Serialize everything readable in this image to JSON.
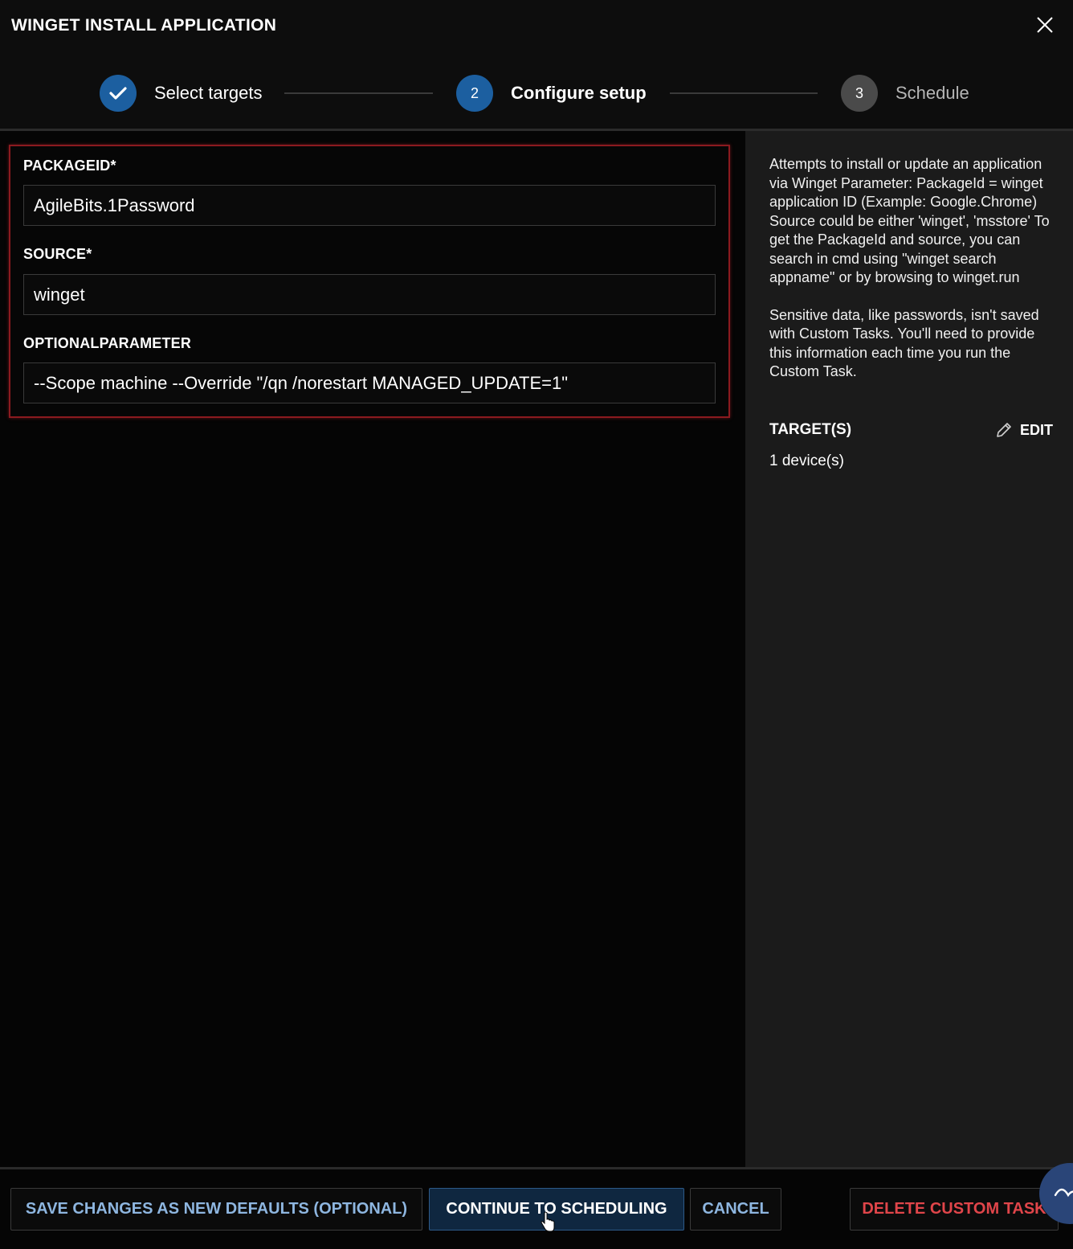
{
  "dialog": {
    "title": "WINGET INSTALL APPLICATION"
  },
  "steps": [
    {
      "number": "",
      "label": "Select targets",
      "state": "completed"
    },
    {
      "number": "2",
      "label": "Configure setup",
      "state": "active"
    },
    {
      "number": "3",
      "label": "Schedule",
      "state": "pending"
    }
  ],
  "form": {
    "fields": [
      {
        "label": "PACKAGEID*",
        "value": "AgileBits.1Password"
      },
      {
        "label": "SOURCE*",
        "value": "winget"
      },
      {
        "label": "OPTIONALPARAMETER",
        "value": "--Scope machine --Override \"/qn /norestart MANAGED_UPDATE=1\""
      }
    ]
  },
  "sidebar": {
    "description": "Attempts to install or update an application via Winget Parameter: PackageId = winget application ID (Example: Google.Chrome) Source could be either 'winget', 'msstore' To get the PackageId and source, you can search in cmd using \"winget search appname\" or by browsing to winget.run",
    "sensitive_note": "Sensitive data, like passwords, isn't saved with Custom Tasks. You'll need to provide this information each time you run the Custom Task.",
    "targets_label": "TARGET(S)",
    "edit_label": "EDIT",
    "targets_value": "1 device(s)"
  },
  "footer": {
    "save_label": "SAVE CHANGES AS NEW DEFAULTS (OPTIONAL)",
    "continue_label": "CONTINUE TO SCHEDULING",
    "cancel_label": "CANCEL",
    "delete_label": "DELETE CUSTOM TASK"
  },
  "colors": {
    "accent": "#1c5fa0",
    "error_border": "#8b1a1f",
    "danger": "#e0454a",
    "link": "#8eb6e0"
  },
  "icons": {
    "close": "close-icon",
    "check": "checkmark-icon",
    "edit": "pencil-icon"
  }
}
